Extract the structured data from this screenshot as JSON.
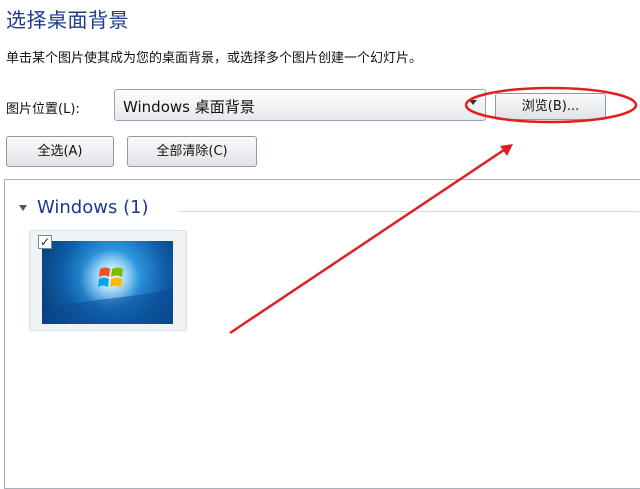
{
  "header": {
    "title": "选择桌面背景",
    "description": "单击某个图片使其成为您的桌面背景，或选择多个图片创建一个幻灯片。"
  },
  "picture_location": {
    "label": "图片位置(L):",
    "selected_value": "Windows 桌面背景",
    "browse_button": "浏览(B)..."
  },
  "actions": {
    "select_all": "全选(A)",
    "clear_all": "全部清除(C)"
  },
  "gallery": {
    "group_label": "Windows (1)",
    "items": [
      {
        "checked": true,
        "checkbox_glyph": "✓"
      }
    ]
  },
  "annotation": {
    "color": "#e02020",
    "type": "red-circle-and-arrow"
  }
}
